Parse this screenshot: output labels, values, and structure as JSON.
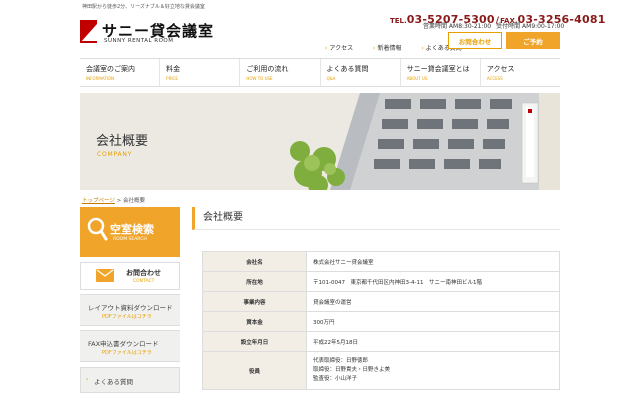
{
  "header": {
    "tagline": "神田駅から徒歩2分、リーズナブル＆好立地な貸会議室",
    "logo_title": "サニー貸会議室",
    "logo_sub": "SUNNY RENTAL ROOM",
    "tel_label": "TEL.",
    "tel": "03-5207-5300",
    "separator": "/",
    "fax_label": "FAX.",
    "fax": "03-3256-4081",
    "hours_business": "営業時間 AM8:30-21:00",
    "hours_reception": "受付時間 AM9:00-17:00",
    "top_links": [
      "アクセス",
      "新着情報",
      "よくある質問"
    ],
    "contact_button": "お問合わせ",
    "reserve_button": "ご予約"
  },
  "nav": [
    {
      "jp": "会議室のご案内",
      "en": "INFORMATION"
    },
    {
      "jp": "料金",
      "en": "PRICE"
    },
    {
      "jp": "ご利用の流れ",
      "en": "HOW TO USE"
    },
    {
      "jp": "よくある質問",
      "en": "Q&A"
    },
    {
      "jp": "サニー貸会議室とは",
      "en": "ABOUT US"
    },
    {
      "jp": "アクセス",
      "en": "ACCESS"
    }
  ],
  "hero": {
    "title": "会社概要",
    "subtitle": "COMPANY"
  },
  "breadcrumb": {
    "home": "トップページ",
    "sep": ">",
    "current": "会社概要"
  },
  "sidebar": {
    "search_title": "空室検索",
    "search_sub": "ROOM SEARCH",
    "contact_title": "お問合わせ",
    "contact_sub": "CONTACT",
    "layout_dl_title": "レイアウト資料ダウンロード",
    "layout_dl_sub": "PDFファイルはコチラ",
    "fax_dl_title": "FAX申込書ダウンロード",
    "fax_dl_sub": "PDFファイルはコチラ",
    "faq_title": "よくある質問"
  },
  "main": {
    "page_title": "会社概要",
    "rows": [
      {
        "label": "会社名",
        "value": "株式会社サニー貸会議室"
      },
      {
        "label": "所在地",
        "value": "〒101-0047　東京都千代田区内神田3-4-11　サニー南神田ビル1階"
      },
      {
        "label": "事業内容",
        "value": "貸会議室の運営"
      },
      {
        "label": "資本金",
        "value": "300万円"
      },
      {
        "label": "設立年月日",
        "value": "平成22年5月18日"
      }
    ],
    "officers_label": "役員",
    "officers": [
      "代表取締役：日野徳郎",
      "取締役：日野貴夫・日野きよ美",
      "監査役：小山洋子"
    ]
  },
  "colors": {
    "accent": "#f0a52a",
    "brand_red": "#c00000",
    "tel_red": "#8a1a1a"
  }
}
